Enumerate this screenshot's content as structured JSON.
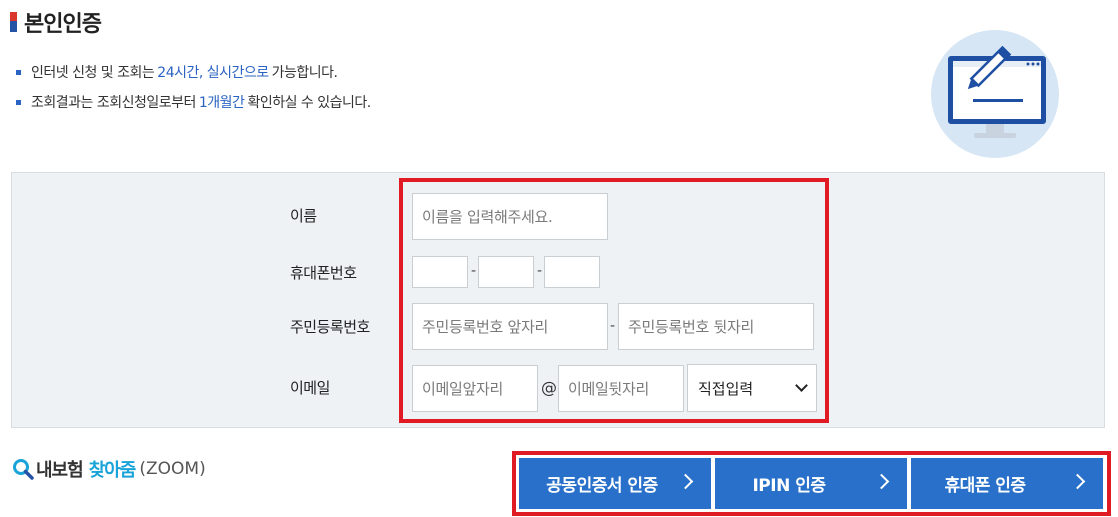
{
  "header": {
    "title": "본인인증"
  },
  "notes": [
    {
      "pre": "인터넷 신청 및 조회는",
      "highlight": "24시간, 실시간으로",
      "post": "가능합니다."
    },
    {
      "pre": "조회결과는 조회신청일로부터",
      "highlight": "1개월간",
      "post": "확인하실 수 있습니다."
    }
  ],
  "form": {
    "name_label": "이름",
    "name_placeholder": "이름을 입력해주세요.",
    "phone_label": "휴대폰번호",
    "phone_sep": "-",
    "rrn_label": "주민등록번호",
    "rrn_front_placeholder": "주민등록번호 앞자리",
    "rrn_back_placeholder": "주민등록번호 뒷자리",
    "rrn_sep": "-",
    "email_label": "이메일",
    "email_id_placeholder": "이메일앞자리",
    "email_at": "@",
    "email_domain_placeholder": "이메일뒷자리",
    "email_domain_select": "직접입력"
  },
  "zoom": {
    "part1": "내보험",
    "part2": "찾아줌",
    "part3": "(ZOOM)"
  },
  "buttons": {
    "cert": "공동인증서 인증",
    "ipin": "IPIN 인증",
    "phone": "휴대폰 인증"
  },
  "colors": {
    "accent": "#2870c9",
    "highlight": "#e01b24",
    "form_bg": "#eef2f5"
  }
}
